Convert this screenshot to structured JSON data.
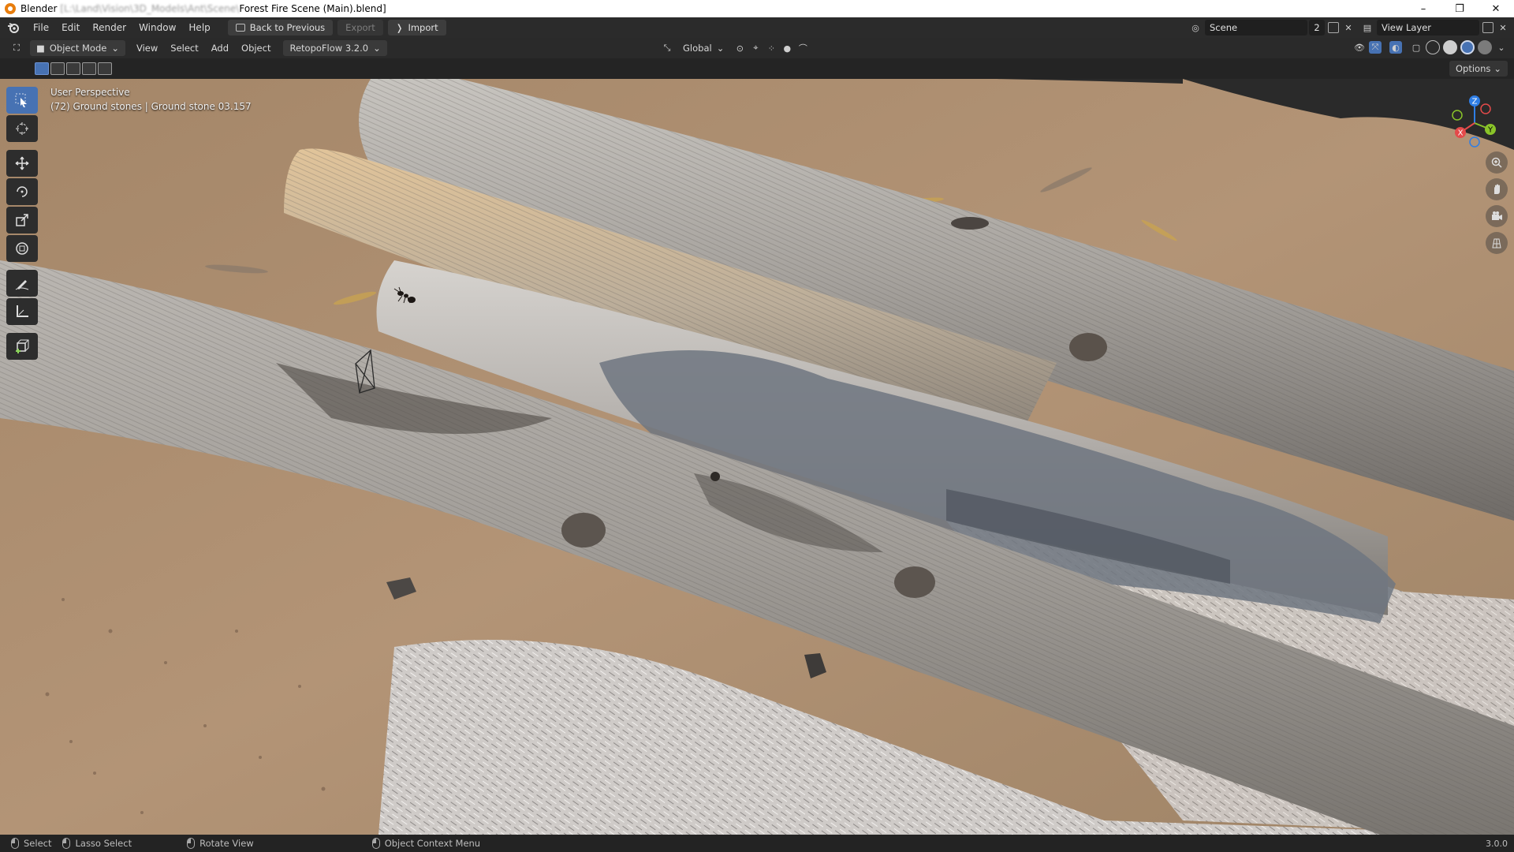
{
  "window": {
    "app_name": "Blender",
    "path_blurred": "[L:\\Land\\Vision\\3D_Models\\Ant\\Scene\\",
    "file_name": "Forest Fire Scene (Main).blend]",
    "controls": {
      "minimize": "–",
      "restore": "❐",
      "close": "✕"
    }
  },
  "topbar": {
    "menus": [
      "File",
      "Edit",
      "Render",
      "Window",
      "Help"
    ],
    "back_button": "Back to Previous",
    "export_button": "Export",
    "import_button": "Import",
    "scene_label": "Scene",
    "scene_users": "2",
    "view_layer_label": "View Layer"
  },
  "viewport_header": {
    "mode": "Object Mode",
    "menus": [
      "View",
      "Select",
      "Add",
      "Object"
    ],
    "addon": "RetopoFlow 3.2.0",
    "transform_orientation": "Global"
  },
  "tool_settings": {
    "options_label": "Options"
  },
  "overlay": {
    "view_name": "User Perspective",
    "object_info": "(72) Ground stones | Ground stone 03.157"
  },
  "gizmo": {
    "x_label": "X",
    "y_label": "Y",
    "z_label": "Z",
    "colors": {
      "x": "#e44a4a",
      "y": "#8ac429",
      "z": "#2e7ee6"
    }
  },
  "statusbar": {
    "select": "Select",
    "lasso_select": "Lasso Select",
    "rotate_view": "Rotate View",
    "context_menu": "Object Context Menu",
    "version": "3.0.0"
  },
  "colors": {
    "accent": "#4772b3",
    "sand": "#a88a6c",
    "wood": "#9d9890"
  }
}
